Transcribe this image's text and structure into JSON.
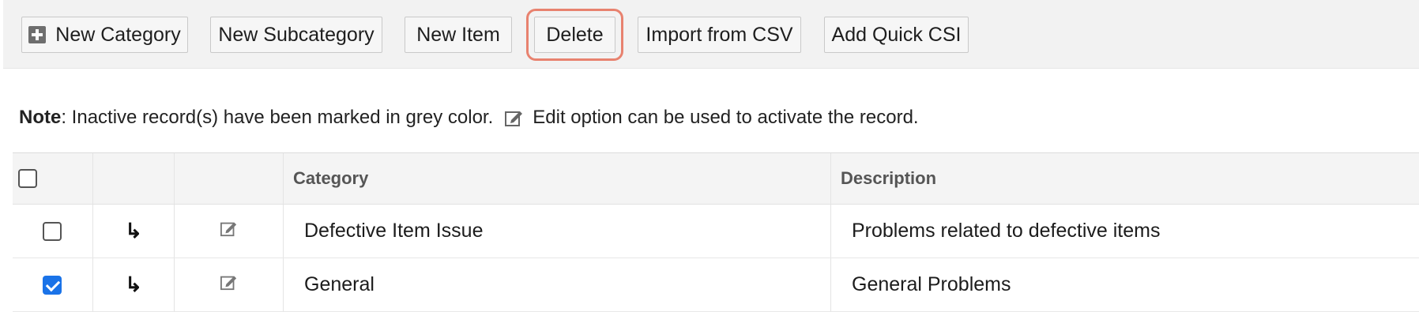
{
  "toolbar": {
    "buttons": [
      {
        "label": "New Category"
      },
      {
        "label": "New Subcategory"
      },
      {
        "label": "New Item"
      },
      {
        "label": "Delete"
      },
      {
        "label": "Import from CSV"
      },
      {
        "label": "Add Quick CSI"
      }
    ]
  },
  "note": {
    "label": "Note",
    "text_before": " : Inactive record(s) have been marked in grey color.",
    "text_after": "Edit option can be used to activate the record."
  },
  "table": {
    "headers": {
      "category": "Category",
      "description": "Description"
    },
    "rows": [
      {
        "category": "Defective Item Issue",
        "description": "Problems related to defective items",
        "checked": false
      },
      {
        "category": "General",
        "description": "General Problems",
        "checked": true
      }
    ]
  },
  "icons": {
    "subcategory": "return-arrow-icon",
    "edit": "edit-icon"
  },
  "colors": {
    "highlight": "#e8826f",
    "checkbox_checked": "#1a73e8"
  }
}
